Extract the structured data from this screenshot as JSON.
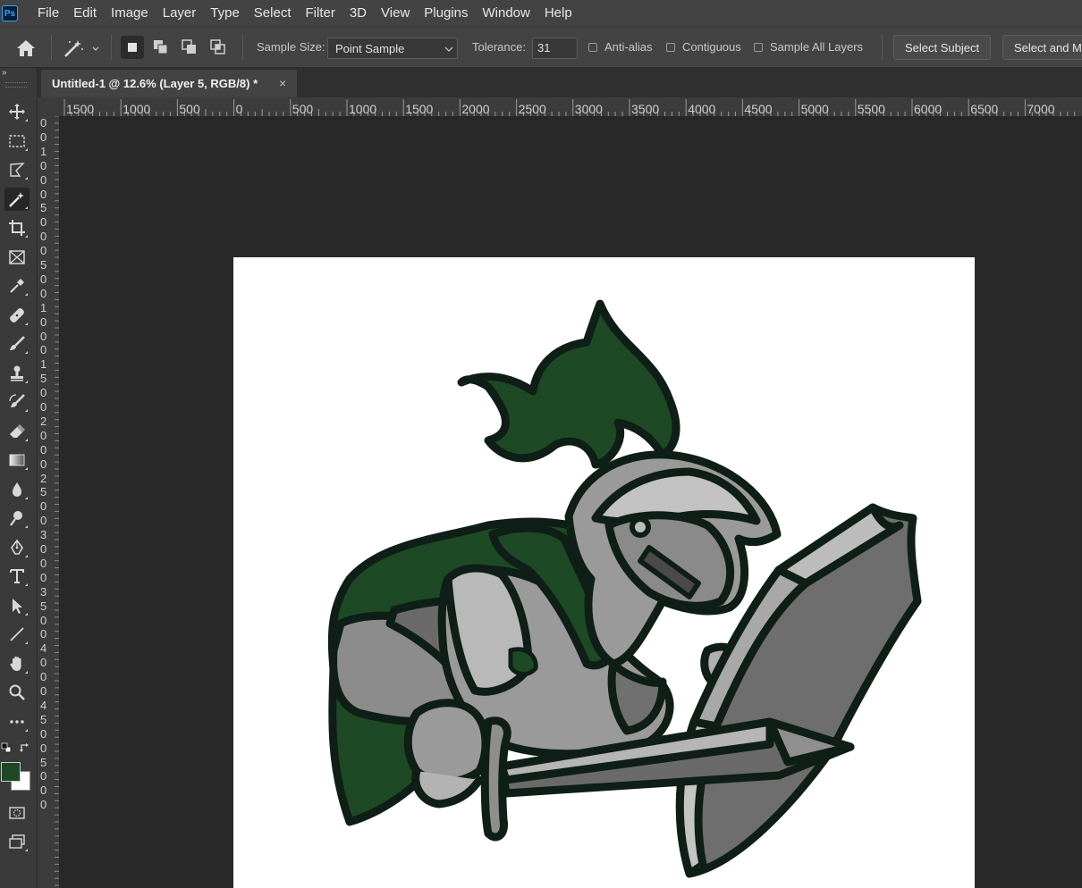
{
  "app": {
    "logo_text": "Ps"
  },
  "menu": [
    "File",
    "Edit",
    "Image",
    "Layer",
    "Type",
    "Select",
    "Filter",
    "3D",
    "View",
    "Plugins",
    "Window",
    "Help"
  ],
  "options_bar": {
    "sample_size_label": "Sample Size:",
    "sample_size_value": "Point Sample",
    "tolerance_label": "Tolerance:",
    "tolerance_value": "31",
    "anti_alias_label": "Anti-alias",
    "contiguous_label": "Contiguous",
    "sample_all_layers_label": "Sample All Layers",
    "select_subject_label": "Select Subject",
    "select_and_mask_label": "Select and Ma"
  },
  "document_tab": {
    "title": "Untitled-1 @ 12.6% (Layer 5, RGB/8) *",
    "close_glyph": "×"
  },
  "ruler": {
    "horizontal": [
      "1500",
      "1000",
      "500",
      "0",
      "500",
      "1000",
      "1500",
      "2000",
      "2500",
      "3000",
      "3500",
      "4000",
      "4500",
      "5000",
      "5500",
      "6000",
      "6500",
      "7000"
    ],
    "vertical": [
      "0",
      "0",
      "1",
      "0",
      "0",
      "0",
      "5",
      "0",
      "0",
      "0",
      "5",
      "0",
      "0",
      "1",
      "0",
      "0",
      "0",
      "1",
      "5",
      "0",
      "0",
      "2",
      "0",
      "0",
      "0",
      "2",
      "5",
      "0",
      "0",
      "3",
      "0",
      "0",
      "0",
      "3",
      "5",
      "0",
      "0",
      "4",
      "0",
      "0",
      "0",
      "4",
      "5",
      "0",
      "0",
      "5",
      "0",
      "0",
      "0"
    ]
  },
  "tools": [
    "move",
    "marquee",
    "lasso",
    "magic-wand",
    "crop",
    "frame",
    "eyedropper",
    "healing",
    "brush",
    "clone-stamp",
    "history-brush",
    "eraser",
    "gradient",
    "blur",
    "dodge",
    "pen",
    "type",
    "path-selection",
    "line",
    "hand",
    "zoom",
    "more"
  ],
  "colors": {
    "foreground": "#1d4a24",
    "background": "#ffffff",
    "accent": "#31a8ff"
  }
}
